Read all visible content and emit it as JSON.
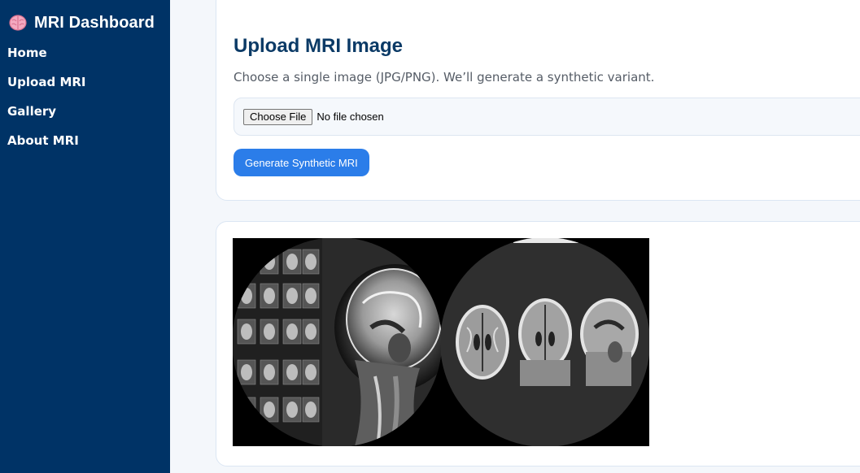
{
  "sidebar": {
    "brand_icon": "brain-icon",
    "title": "MRI Dashboard",
    "items": [
      {
        "label": "Home"
      },
      {
        "label": "Upload MRI"
      },
      {
        "label": "Gallery"
      },
      {
        "label": "About MRI"
      }
    ]
  },
  "upload": {
    "title": "Upload MRI Image",
    "description": "Choose a single image (JPG/PNG). We’ll generate a synthetic variant.",
    "file_button": "Choose File",
    "file_status": "No file chosen",
    "generate_button": "Generate Synthetic MRI"
  },
  "colors": {
    "sidebar_bg": "#003366",
    "accent": "#2b7de9",
    "heading": "#0b3a66"
  }
}
